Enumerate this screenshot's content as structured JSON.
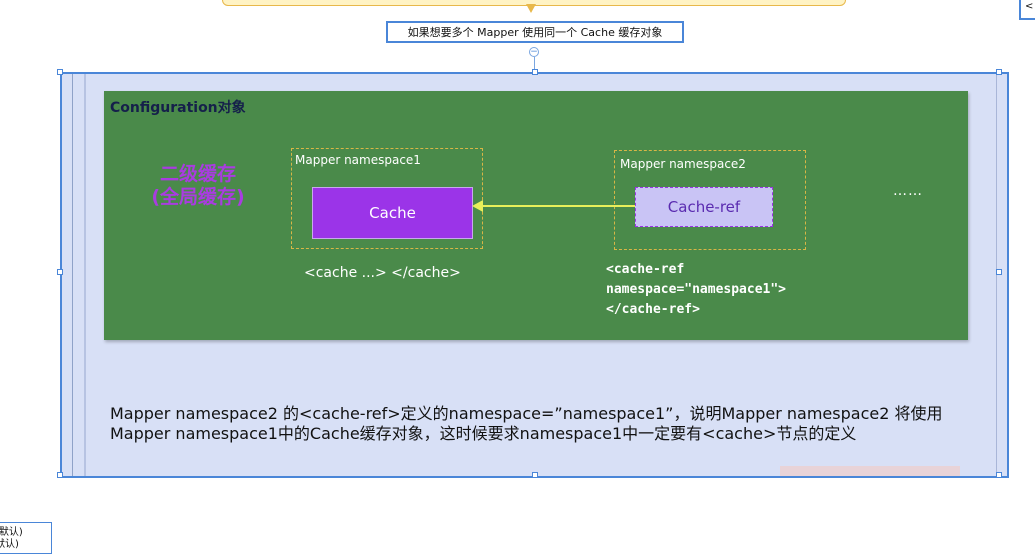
{
  "topic_node": "如果想要多个 Mapper 使用同一个 Cache 缓存对象",
  "diagram": {
    "title": "Configuration对象",
    "level2_line1": "二级缓存",
    "level2_line2": "(全局缓存)",
    "namespace1": "Mapper namespace1",
    "namespace2": "Mapper namespace2",
    "cache": "Cache",
    "cache_ref": "Cache-ref",
    "ellipsis": "……",
    "cache_tag": "<cache ...> </cache>",
    "cache_ref_tag": "<cache-ref\nnamespace=\"namespace1\">\n</cache-ref>",
    "description": "Mapper namespace2 的<cache-ref>定义的namespace=”namespace1”，说明Mapper namespace2 将使用Mapper namespace1中的Cache缓存对象，这时候要求namespace1中一定要有<cache>节点的定义"
  },
  "side_nodes": {
    "bottom_left": "(默认)\n默认)",
    "right_edge": "<"
  },
  "colors": {
    "panel_green": "#4a8a4a",
    "cache_purple": "#9b34e8",
    "frame_blue": "#4a86d8",
    "arrow_yellow": "#e8ef5a"
  }
}
